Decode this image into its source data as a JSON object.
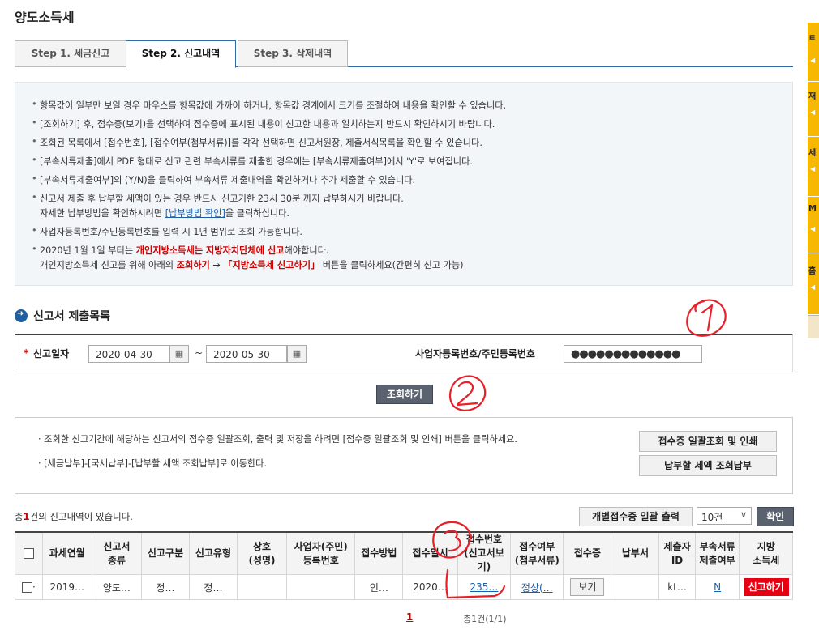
{
  "page_title": "양도소득세",
  "tabs": [
    "Step 1. 세금신고",
    "Step 2. 신고내역",
    "Step 3. 삭제내역"
  ],
  "notices": [
    "항목값이 일부만 보일 경우 마우스를 항목값에 가까이 하거나, 항목값 경계에서 크기를 조절하여 내용을 확인할 수 있습니다.",
    "[조회하기] 후, 접수증(보기)을 선택하여 접수증에 표시된 내용이 신고한 내용과 일치하는지 반드시 확인하시기 바랍니다.",
    "조회된 목록에서 [접수번호], [접수여부(첨부서류)]를 각각 선택하면 신고서원장, 제출서식목록을 확인할 수 있습니다.",
    "[부속서류제출]에서 PDF 형태로 신고 관련 부속서류를 제출한 경우에는 [부속서류제출여부]에서 'Y'로 보여집니다.",
    "[부속서류제출여부]의 (Y/N)을 클릭하여 부속서류 제출내역을 확인하거나 추가 제출할 수 있습니다.",
    "신고서 제출 후 납부할 세액이 있는 경우 반드시 신고기한 23시 30분 까지 납부하시기 바랍니다."
  ],
  "notice6_line2_pre": "자세한 납부방법을 확인하시려면 ",
  "notice6_link": "[납부방법 확인]",
  "notice6_line2_post": "을 클릭하십니다.",
  "notice7": "사업자등록번호/주민등록번호를 입력 시 1년 범위로 조회 가능합니다.",
  "notice8_pre": "2020년 1월 1일 부터는 ",
  "notice8_red": "개인지방소득세는 지방자치단체에 신고",
  "notice8_post": "해야합니다.",
  "notice8_line2_pre": "개인지방소득세 신고를 위해 아래의 ",
  "notice8_line2_red1": "조회하기",
  "notice8_line2_arrow": " → ",
  "notice8_line2_red2": "「지방소득세 신고하기」",
  "notice8_line2_post": " 버튼을 클릭하세요(간편히 신고 가능)",
  "section_title": "신고서 제출목록",
  "search": {
    "date_label": "신고일자",
    "required_mark": "*",
    "date_from": "2020-04-30",
    "date_to": "2020-05-30",
    "tilde": "~",
    "id_label": "사업자등록번호/주민등록번호",
    "id_value": "●●●●●●●●●●●●●"
  },
  "query_button": "조회하기",
  "info_lines": [
    "· 조회한 신고기간에 해당하는 신고서의 접수증 일괄조회, 출력 및 저장을 하려면 [접수증 일괄조회 및 인쇄] 버튼을 클릭하세요.",
    "· [세금납부]-[국세납부]-[납부할 세액 조회납부]로 이동한다."
  ],
  "btn_receipt_batch": "접수증 일괄조회 및 인쇄",
  "btn_tax_pay": "납부할 세액 조회납부",
  "count_pre": "총",
  "count_num": "1",
  "count_post": "건의 신고내역이 있습니다.",
  "btn_print_individual": "개별접수증 일괄 출력",
  "page_size": "10건",
  "btn_confirm": "확인",
  "table_headers": [
    "",
    "과세연월",
    "신고서\n종류",
    "신고구분",
    "신고유형",
    "상호\n(성명)",
    "사업자(주민)\n등록번호",
    "접수방법",
    "접수일시",
    "접수번호\n(신고서보기)",
    "접수여부\n(첨부서류)",
    "접수증",
    "납부서",
    "제출자\nID",
    "부속서류\n제출여부",
    "지방\n소득세"
  ],
  "row": {
    "period": "2019…",
    "kind": "양도…",
    "div": "정…",
    "type": "정…",
    "name": "",
    "regno": "",
    "method": "인…",
    "datetime": "2020…",
    "recv_no": "235…",
    "recv_status": "정상(…",
    "receipt_btn": "보기",
    "payment": "",
    "submitter": "kt…",
    "attach": "N",
    "local_tax_btn": "신고하기"
  },
  "pagination": {
    "current": "1",
    "summary": "총1건(1/1)"
  },
  "sidebar_labels": [
    "ㅌ",
    "재",
    "세",
    "M",
    "홈"
  ],
  "colors": {
    "accent": "#1d5fa0",
    "red_button": "#e60012",
    "annotation": "#e8202a",
    "sidebar": "#f6b800"
  }
}
